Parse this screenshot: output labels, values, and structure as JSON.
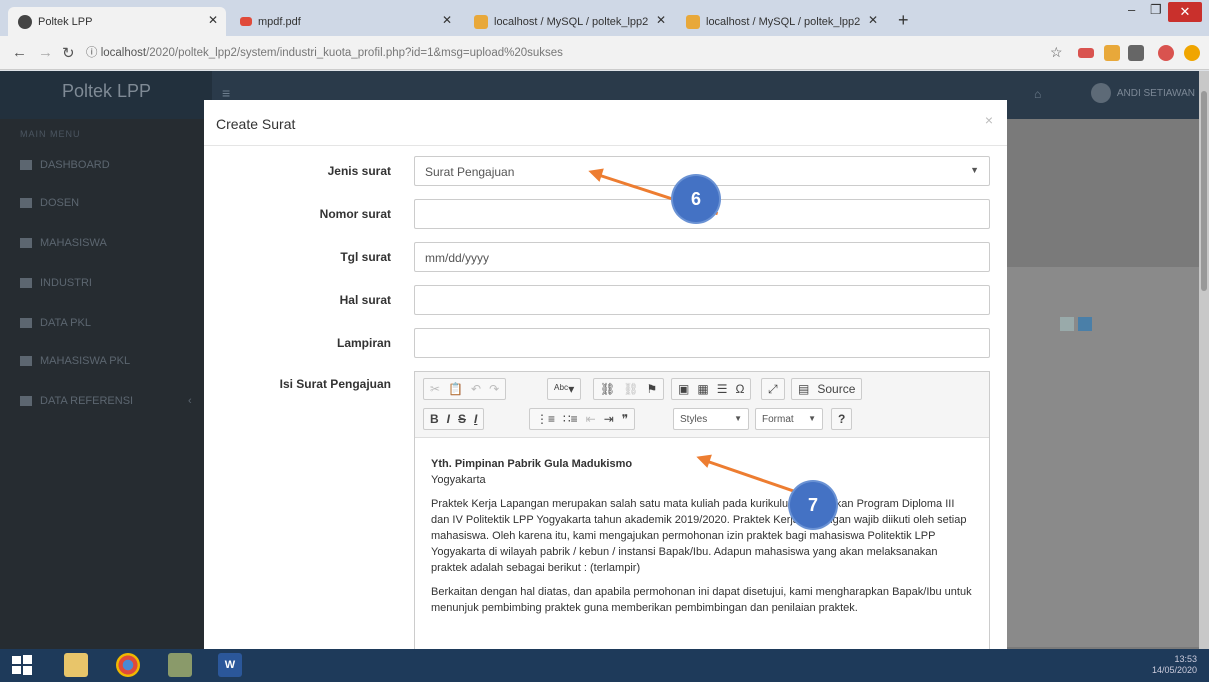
{
  "browser": {
    "tabs": [
      {
        "label": "Poltek LPP",
        "active": true
      },
      {
        "label": "mpdf.pdf",
        "active": false
      },
      {
        "label": "localhost / MySQL / poltek_lpp2",
        "active": false
      },
      {
        "label": "localhost / MySQL / poltek_lpp2",
        "active": false
      }
    ],
    "url_host": "localhost",
    "url_path": "/2020/poltek_lpp2/system/industri_kuota_profil.php?id=1&msg=upload%20sukses"
  },
  "app": {
    "brand": "Poltek LPP",
    "nav_header": "MAIN MENU",
    "user_name": "ANDI SETIAWAN",
    "sidebar": [
      {
        "label": "DASHBOARD"
      },
      {
        "label": "DOSEN"
      },
      {
        "label": "MAHASISWA"
      },
      {
        "label": "INDUSTRI"
      },
      {
        "label": "DATA PKL"
      },
      {
        "label": "MAHASISWA PKL"
      },
      {
        "label": "DATA REFERENSI"
      }
    ]
  },
  "modal": {
    "title": "Create Surat",
    "close": "×",
    "fields": {
      "jenis": {
        "label": "Jenis surat",
        "value": "Surat Pengajuan"
      },
      "nomor": {
        "label": "Nomor surat",
        "value": ""
      },
      "tgl": {
        "label": "Tgl surat",
        "placeholder": "mm/dd/yyyy"
      },
      "hal": {
        "label": "Hal surat",
        "value": ""
      },
      "lampiran": {
        "label": "Lampiran",
        "value": ""
      },
      "isi": {
        "label": "Isi Surat Pengajuan"
      }
    },
    "editor": {
      "source_label": "Source",
      "styles_label": "Styles",
      "format_label": "Format",
      "help_label": "?",
      "content": {
        "heading": "Yth. Pimpinan Pabrik Gula Madukismo",
        "city": "Yogyakarta",
        "para1": "Praktek Kerja Lapangan merupakan salah satu mata kuliah pada kurikulum pendidikan Program Diploma III dan IV Politektik LPP Yogyakarta tahun akademik 2019/2020. Praktek Kerja Lapangan wajib diikuti oleh setiap mahasiswa. Oleh karena itu, kami mengajukan permohonan izin praktek bagi mahasiswa Politektik LPP Yogyakarta di wilayah pabrik / kebun / instansi Bapak/Ibu. Adapun mahasiswa yang akan melaksanakan praktek adalah sebagai berikut : (terlampir)",
        "para2": "Berkaitan dengan hal diatas, dan apabila permohonan ini dapat disetujui, kami mengharapkan Bapak/Ibu untuk menunjuk pembimbing praktek guna memberikan pembimbingan dan penilaian praktek."
      }
    }
  },
  "annotations": {
    "callout1": "6",
    "callout2": "7",
    "color_callout": "#4472c4",
    "color_arrow": "#ed7d31"
  },
  "taskbar": {
    "time": "13:53",
    "date": "14/05/2020"
  }
}
